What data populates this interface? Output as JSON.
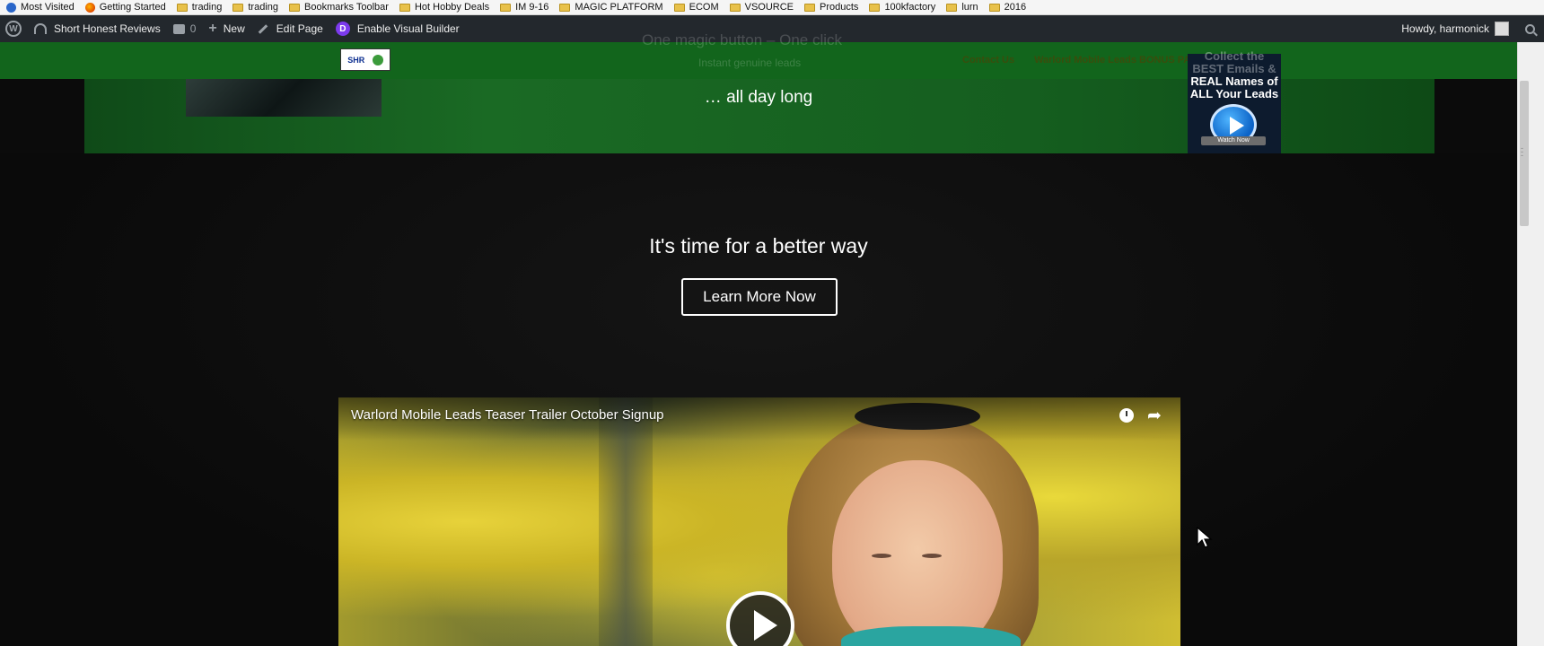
{
  "bookmarks": {
    "items": [
      "Most Visited",
      "Getting Started",
      "trading",
      "trading",
      "Bookmarks Toolbar",
      "Hot Hobby Deals",
      "IM  9-16",
      "MAGIC PLATFORM",
      "ECOM",
      "VSOURCE",
      "Products",
      "100kfactory",
      "lurn",
      "2016"
    ]
  },
  "adminbar": {
    "site_name": "Short Honest Reviews",
    "comments_count": "0",
    "new_label": "New",
    "edit_label": "Edit Page",
    "visual_builder_label": "Enable Visual Builder",
    "greeting": "Howdy, harmonick"
  },
  "header": {
    "nav": [
      "Contact Us",
      "Warlord Mobile Leads BONUS PAGE"
    ],
    "faint_line1": "One magic button – One click",
    "faint_line2": "Instant genuine leads"
  },
  "hero": {
    "line": "… all day long"
  },
  "promo": {
    "line1": "Collect the",
    "line2": "BEST Emails &",
    "line3": "REAL Names of",
    "line4": "ALL Your Leads",
    "watch": "Watch Now"
  },
  "main": {
    "headline": "It's time for a better way",
    "cta_label": "Learn More Now"
  },
  "video": {
    "title": "Warlord Mobile Leads Teaser Trailer October Signup"
  }
}
